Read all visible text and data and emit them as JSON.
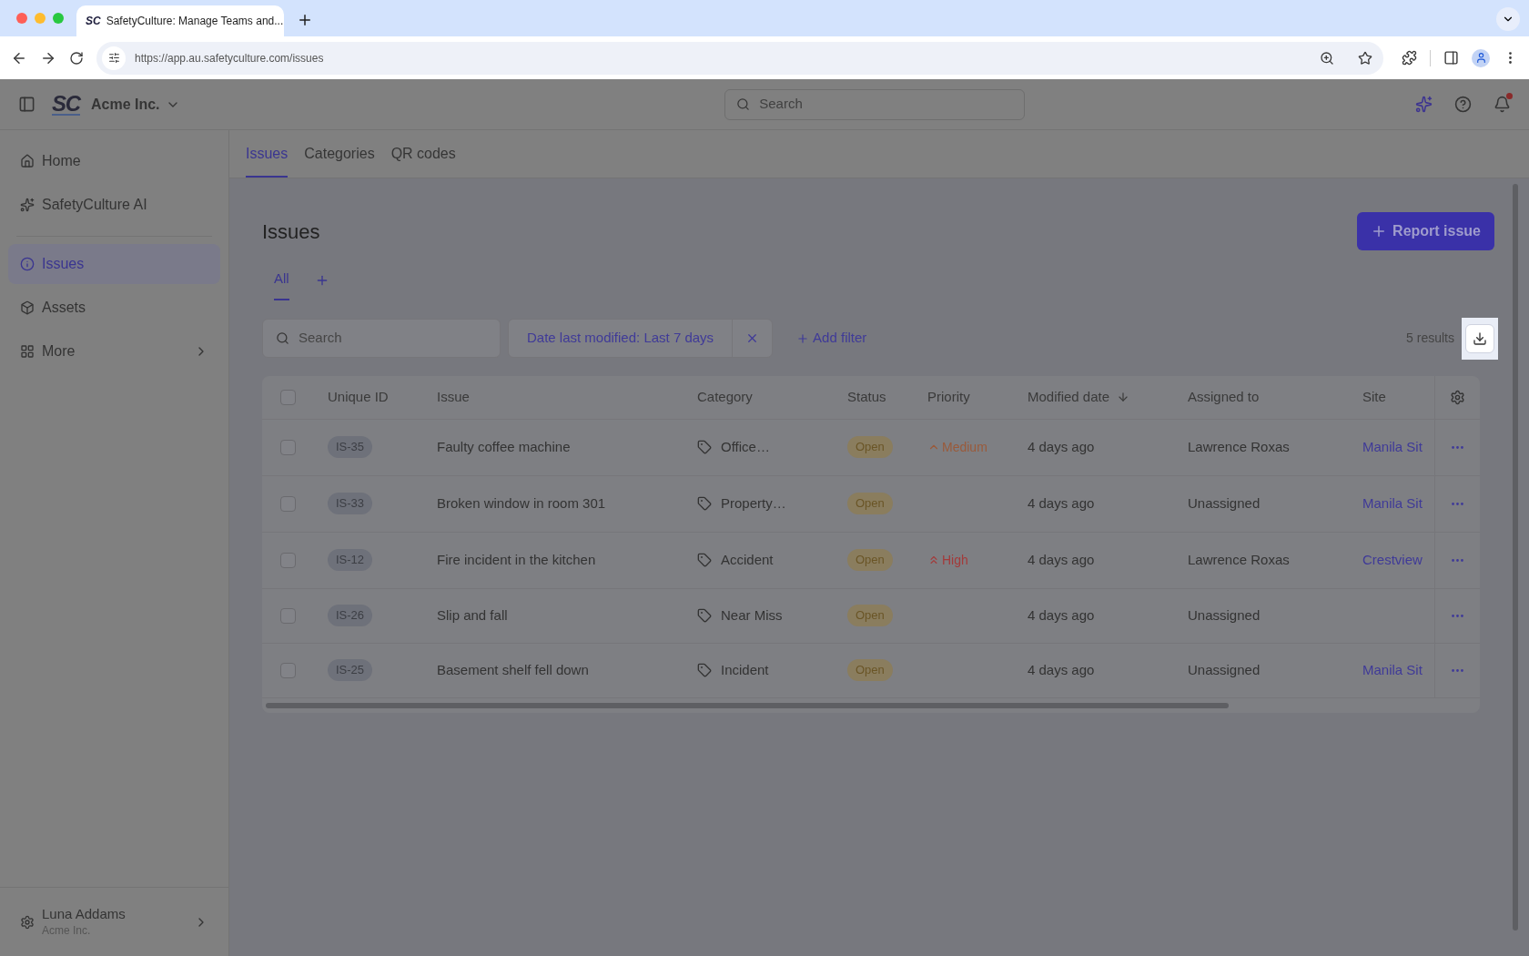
{
  "browser": {
    "favicon_text": "SC",
    "tab_title": "SafetyCulture: Manage Teams and...",
    "url": "https://app.au.safetyculture.com/issues"
  },
  "header": {
    "org_name": "Acme Inc.",
    "search_placeholder": "Search",
    "logo": "SC"
  },
  "sidebar": {
    "items": [
      {
        "label": "Home",
        "selected": false,
        "kind": "link"
      },
      {
        "label": "SafetyCulture AI",
        "selected": false,
        "kind": "link"
      },
      {
        "label": "Issues",
        "selected": true,
        "kind": "link"
      },
      {
        "label": "Assets",
        "selected": false,
        "kind": "link"
      },
      {
        "label": "More",
        "selected": false,
        "kind": "expandable"
      }
    ],
    "user": {
      "name": "Luna Addams",
      "org": "Acme Inc."
    }
  },
  "page_tabs": [
    {
      "label": "Issues",
      "selected": true
    },
    {
      "label": "Categories",
      "selected": false
    },
    {
      "label": "QR codes",
      "selected": false
    }
  ],
  "title": "Issues",
  "report_button": "Report issue",
  "view_tabs": [
    {
      "label": "All",
      "selected": true
    }
  ],
  "search_placeholder": "Search",
  "filter_chip": "Date last modified: Last 7 days",
  "add_filter": "Add filter",
  "results": "5 results",
  "table": {
    "select_all_checked": false,
    "columns": [
      {
        "label": "Unique ID",
        "sorted": false
      },
      {
        "label": "Issue",
        "sorted": false
      },
      {
        "label": "Category",
        "sorted": false
      },
      {
        "label": "Status",
        "sorted": false
      },
      {
        "label": "Priority",
        "sorted": false
      },
      {
        "label": "Modified date",
        "sorted": true
      },
      {
        "label": "Assigned to",
        "sorted": false
      },
      {
        "label": "Site",
        "sorted": false
      }
    ],
    "rows": [
      {
        "checked": false,
        "id": "IS-35",
        "issue": "Faulty coffee machine",
        "category": "Office…",
        "status": "Open",
        "priority": {
          "label": "Medium",
          "kind": "medium"
        },
        "modified": "4 days ago",
        "assigned": "Lawrence Roxas",
        "site": "Manila Sit"
      },
      {
        "checked": false,
        "id": "IS-33",
        "issue": "Broken window in room 301",
        "category": "Property…",
        "status": "Open",
        "modified": "4 days ago",
        "assigned": "Unassigned",
        "site": "Manila Sit"
      },
      {
        "checked": false,
        "id": "IS-12",
        "issue": "Fire incident in the kitchen",
        "category": "Accident",
        "status": "Open",
        "priority": {
          "label": "High",
          "kind": "high"
        },
        "modified": "4 days ago",
        "assigned": "Lawrence Roxas",
        "site": "Crestview"
      },
      {
        "checked": false,
        "id": "IS-26",
        "issue": "Slip and fall",
        "category": "Near Miss",
        "status": "Open",
        "modified": "4 days ago",
        "assigned": "Unassigned"
      },
      {
        "checked": false,
        "id": "IS-25",
        "issue": "Basement shelf fell down",
        "category": "Incident",
        "status": "Open",
        "modified": "4 days ago",
        "assigned": "Unassigned",
        "site": "Manila Sit"
      }
    ]
  }
}
